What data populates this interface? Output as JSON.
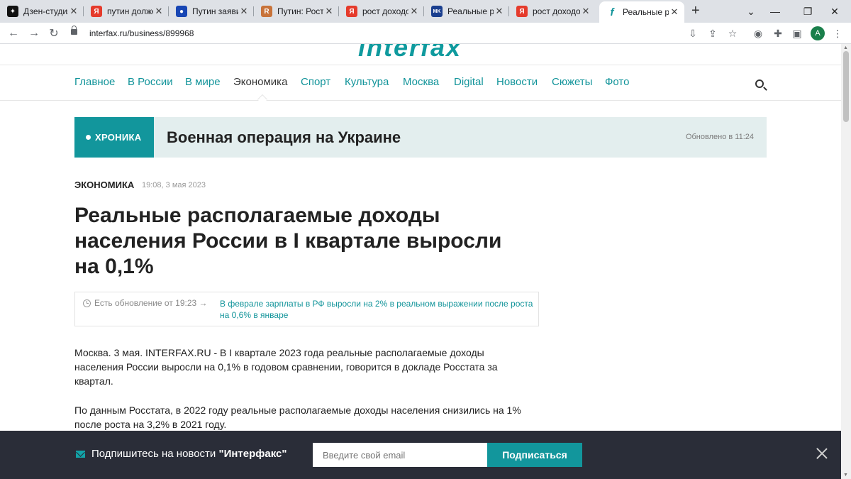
{
  "browser": {
    "tabs": [
      {
        "label": "Дзен-студия",
        "icon": "zen-icon",
        "color": "#111111",
        "glyph": "✦"
      },
      {
        "label": "путин долже",
        "icon": "yandex-icon",
        "color": "#e53b2c",
        "glyph": "Я"
      },
      {
        "label": "Путин заявил",
        "icon": "globe-icon",
        "color": "#1846b4",
        "glyph": "●"
      },
      {
        "label": "Путин: Рост р",
        "icon": "ru-news-icon",
        "color": "#c8733a",
        "glyph": "R"
      },
      {
        "label": "рост доходов",
        "icon": "yandex-icon",
        "color": "#e53b2c",
        "glyph": "Я"
      },
      {
        "label": "Реальные ра",
        "icon": "mk-icon",
        "color": "#1b3f8f",
        "glyph": "MK"
      },
      {
        "label": "рост доходов",
        "icon": "yandex-icon",
        "color": "#e53b2c",
        "glyph": "Я"
      },
      {
        "label": "Реальные ра",
        "icon": "interfax-icon",
        "color": "#12949a",
        "glyph": "f",
        "active": true
      }
    ],
    "new_tab": "+",
    "url": "interfax.ru/business/899968",
    "profile_initial": "A"
  },
  "site": {
    "nav": [
      "Главное",
      "В России",
      "В мире",
      "Экономика",
      "Спорт",
      "Культура",
      "Москва",
      "Digital",
      "Новости",
      "Сюжеты",
      "Фото"
    ],
    "active_nav": "Экономика"
  },
  "chronicle": {
    "tag": "ХРОНИКА",
    "title": "Военная операция на Украине",
    "updated": "Обновлено в 11:24"
  },
  "article": {
    "rubric": "ЭКОНОМИКА",
    "date": "19:08, 3 мая 2023",
    "headline": "Реальные располагаемые доходы населения России в I квартале выросли на 0,1%",
    "update_prefix": "Есть обновление от 19:23 →",
    "update_link": "В феврале зарплаты в РФ выросли на 2% в реальном выражении после роста на 0,6% в январе",
    "paragraphs": [
      "Москва. 3 мая. INTERFAX.RU - В I квартале 2023 года реальные располагаемые доходы населения России выросли на 0,1% в годовом сравнении, говорится в докладе Росстата за квартал.",
      "По данным Росстата, в 2022 году реальные располагаемые доходы населения снизились на 1% после роста на 3,2% в 2021 году."
    ]
  },
  "subscribe": {
    "text_prefix": "Подпишитесь на новости ",
    "brand": "\"Интерфакс\"",
    "placeholder": "Введите свой email",
    "button": "Подписаться"
  }
}
